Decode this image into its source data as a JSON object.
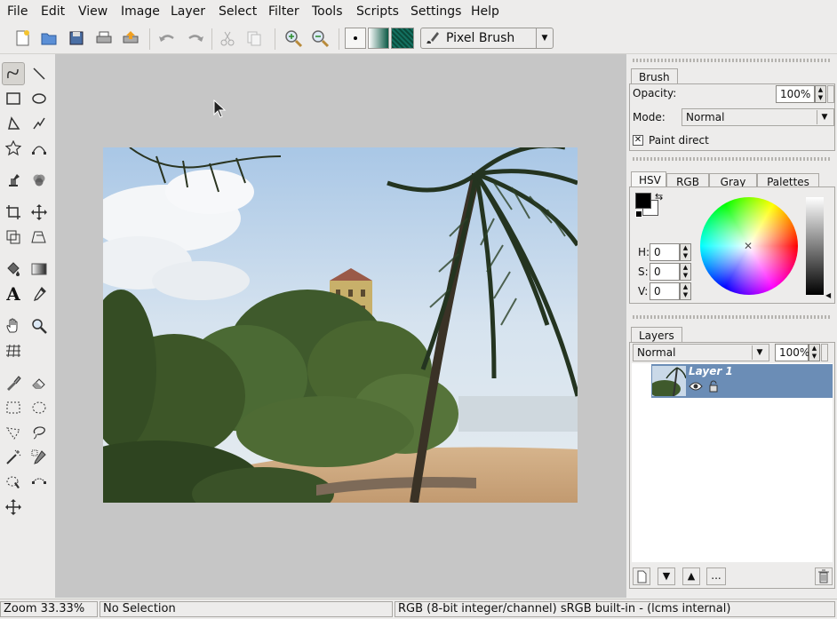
{
  "menubar": [
    "File",
    "Edit",
    "View",
    "Image",
    "Layer",
    "Select",
    "Filter",
    "Tools",
    "Scripts",
    "Settings",
    "Help"
  ],
  "toolbar": {
    "icons": [
      "new-document-icon",
      "open-folder-icon",
      "save-icon",
      "print-icon",
      "export-icon",
      "undo-icon",
      "redo-icon",
      "cut-icon",
      "copy-icon",
      "zoom-in-icon",
      "zoom-out-icon"
    ],
    "brush_preset": "Pixel Brush",
    "colors": {
      "gradient_start": "#ffffff",
      "gradient_end": "#0c5a46",
      "pattern": "#0a4a3a"
    }
  },
  "brush_panel": {
    "tab": "Brush",
    "opacity_label": "Opacity:",
    "opacity_value": "100%",
    "mode_label": "Mode:",
    "mode_value": "Normal",
    "paint_direct_label": "Paint direct",
    "paint_direct_checked": true
  },
  "color_panel": {
    "tabs": [
      "HSV",
      "RGB",
      "Gray",
      "Palettes"
    ],
    "active_tab": "HSV",
    "h_label": "H:",
    "h_value": "0",
    "s_label": "S:",
    "s_value": "0",
    "v_label": "V:",
    "v_value": "0",
    "foreground": "#000000",
    "background": "#ffffff"
  },
  "layers_panel": {
    "tab": "Layers",
    "mode_value": "Normal",
    "opacity_value": "100%",
    "layers": [
      {
        "name": "Layer 1",
        "visible": true,
        "locked": false
      }
    ],
    "more_label": "..."
  },
  "statusbar": {
    "zoom": "Zoom 33.33%",
    "selection": "No Selection",
    "colorspace": "RGB (8-bit integer/channel)  sRGB built-in - (lcms internal)"
  }
}
